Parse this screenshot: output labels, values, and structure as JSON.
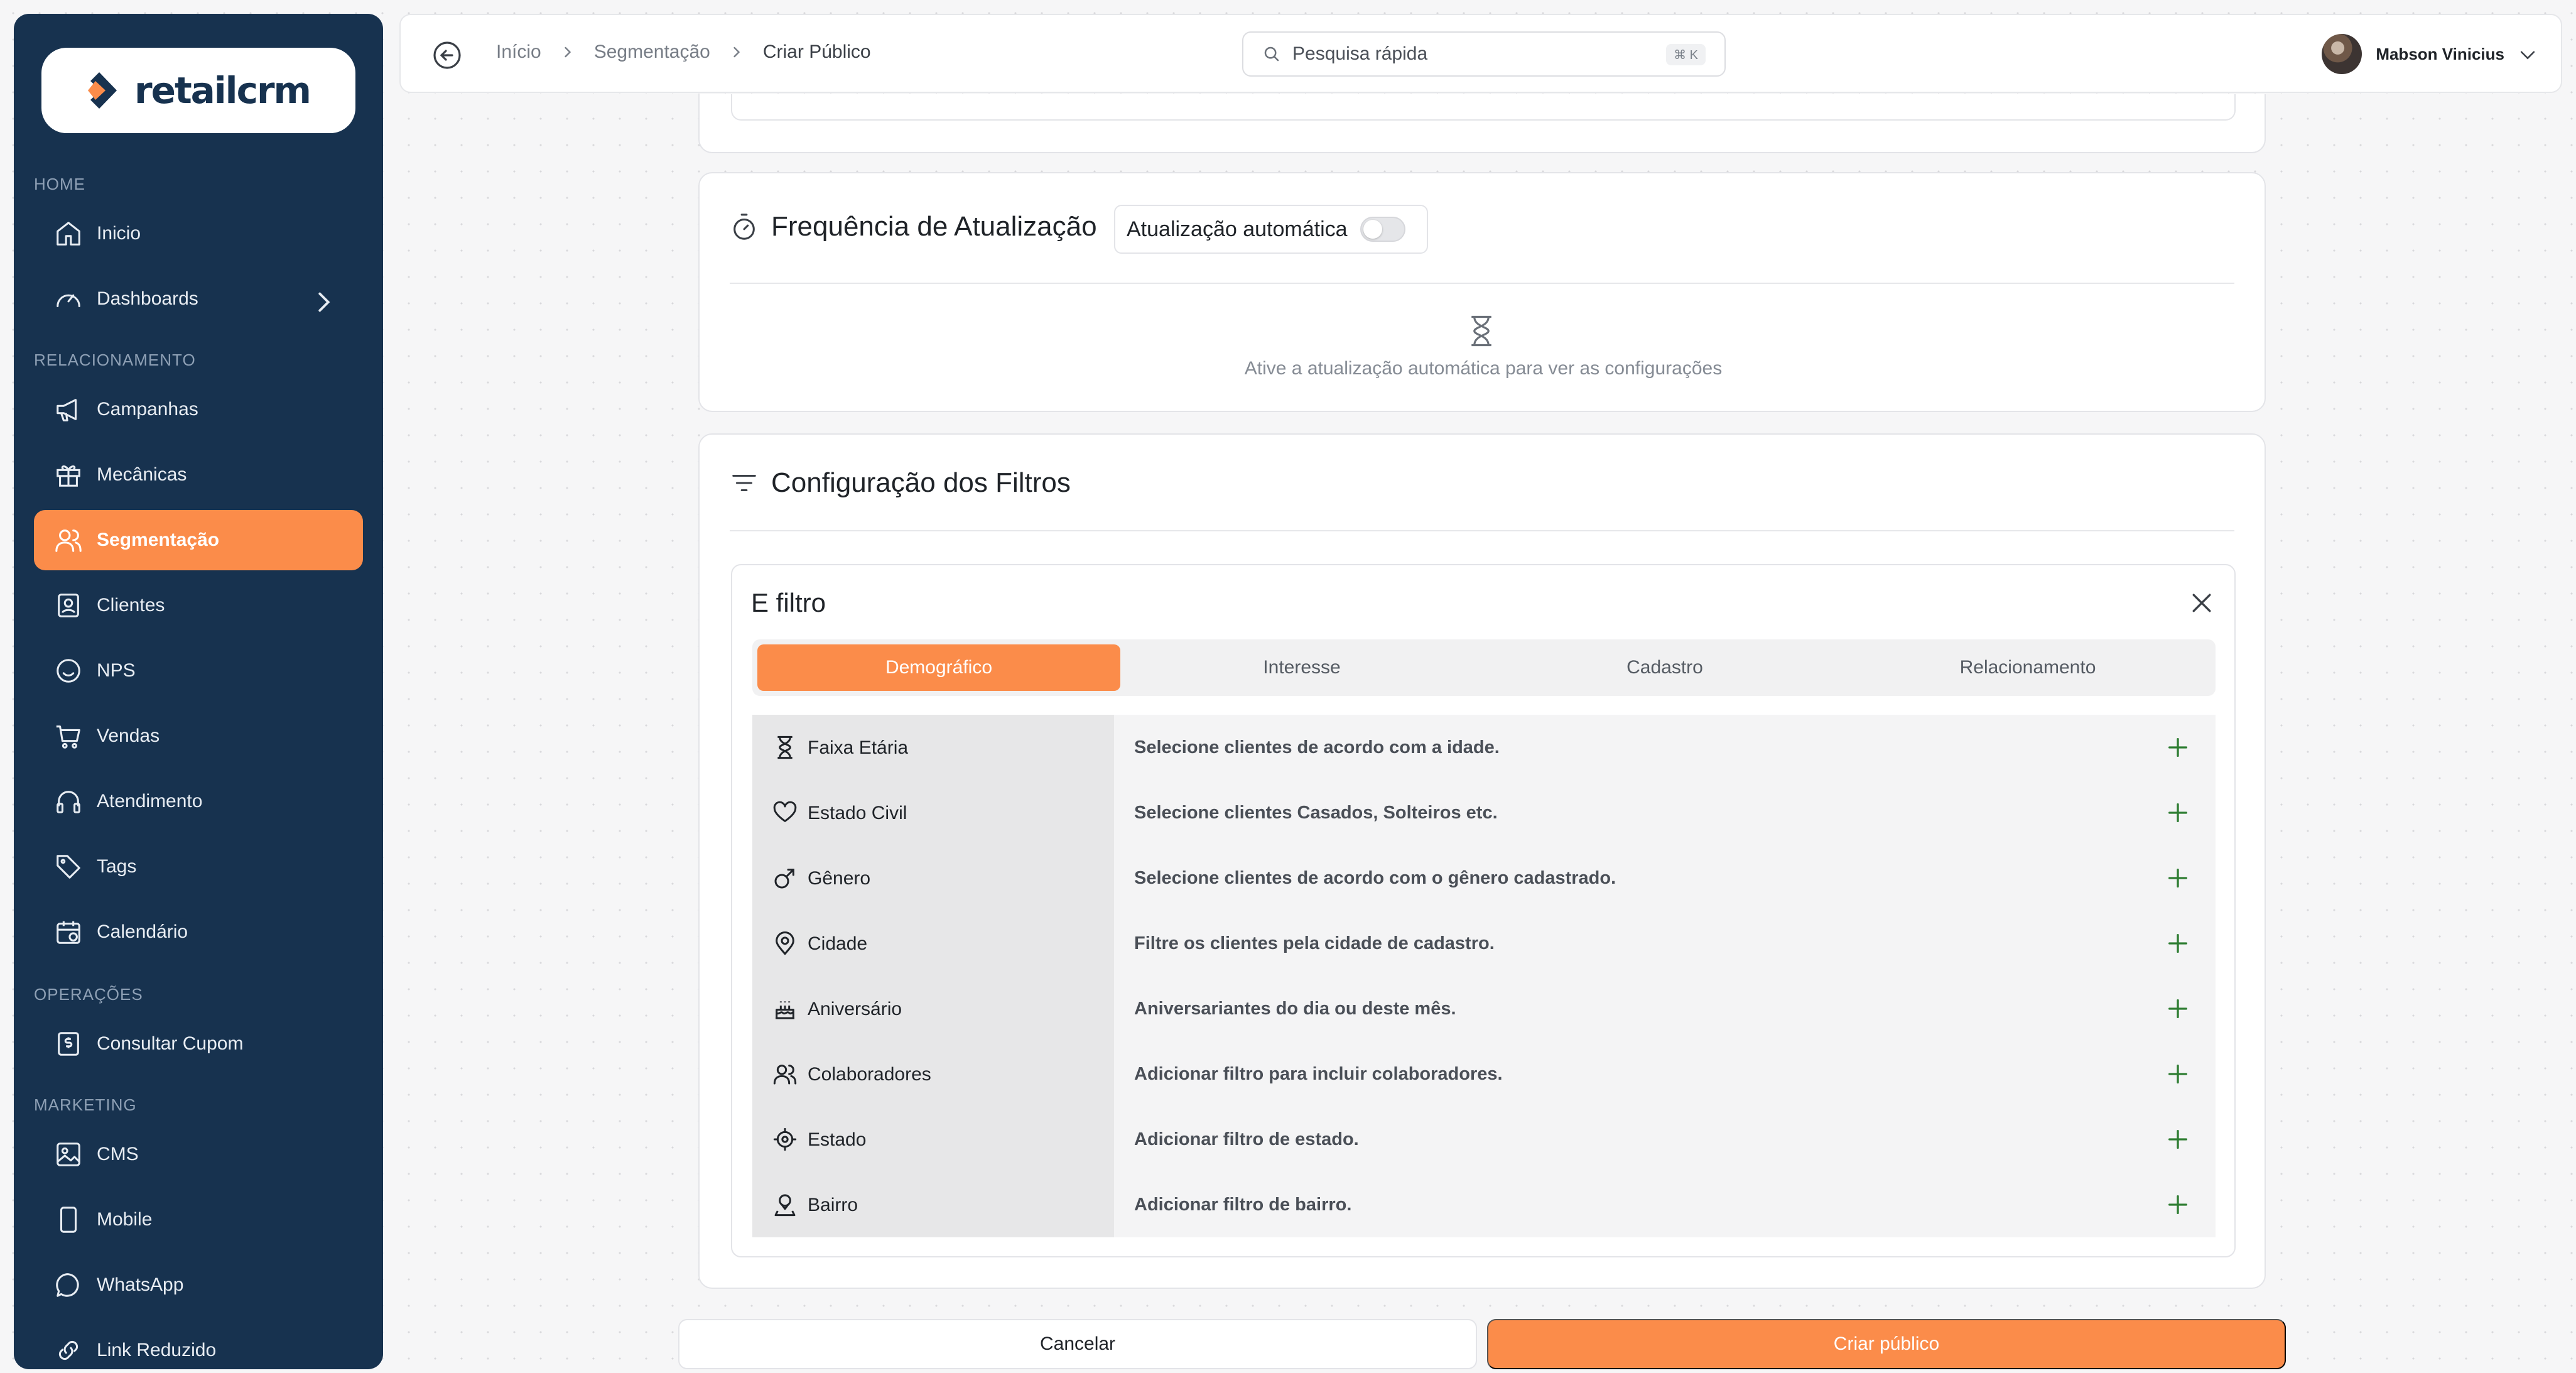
{
  "colors": {
    "sidebar_bg": "#17324f",
    "accent": "#fb8c4a",
    "add_icon": "#2e7d32"
  },
  "brand": {
    "logo_text": "retailcrm"
  },
  "sidebar": {
    "sections": [
      {
        "label": "HOME",
        "items": [
          {
            "label": "Inicio",
            "icon": "home-icon"
          },
          {
            "label": "Dashboards",
            "icon": "gauge-icon"
          }
        ]
      },
      {
        "label": "RELACIONAMENTO",
        "items": [
          {
            "label": "Campanhas",
            "icon": "megaphone-icon"
          },
          {
            "label": "Mecânicas",
            "icon": "gift-icon"
          },
          {
            "label": "Segmentação",
            "icon": "users-icon",
            "active": true
          },
          {
            "label": "Clientes",
            "icon": "contact-icon"
          },
          {
            "label": "NPS",
            "icon": "smile-icon"
          },
          {
            "label": "Vendas",
            "icon": "cart-icon"
          },
          {
            "label": "Atendimento",
            "icon": "headset-icon"
          },
          {
            "label": "Tags",
            "icon": "tag-icon"
          },
          {
            "label": "Calendário",
            "icon": "calendar-icon"
          }
        ]
      },
      {
        "label": "OPERAÇÕES",
        "items": [
          {
            "label": "Consultar Cupom",
            "icon": "receipt-icon"
          }
        ]
      },
      {
        "label": "MARKETING",
        "items": [
          {
            "label": "CMS",
            "icon": "image-icon"
          },
          {
            "label": "Mobile",
            "icon": "smartphone-icon"
          },
          {
            "label": "WhatsApp",
            "icon": "chat-icon"
          },
          {
            "label": "Link Reduzido",
            "icon": "link-icon"
          }
        ]
      }
    ]
  },
  "header": {
    "breadcrumb": [
      "Início",
      "Segmentação",
      "Criar Público"
    ],
    "search_placeholder": "Pesquisa rápida",
    "search_shortcut": "⌘ K",
    "user_name": "Mabson Vinicius"
  },
  "frequency": {
    "title": "Frequência de Atualização",
    "toggle_label": "Atualização automática",
    "toggle_on": false,
    "empty_message": "Ative a atualização automática para ver as configurações"
  },
  "filters_config": {
    "title": "Configuração dos Filtros",
    "box_title": "E filtro",
    "tabs": [
      "Demográfico",
      "Interesse",
      "Cadastro",
      "Relacionamento"
    ],
    "active_tab": 0,
    "rows": [
      {
        "label": "Faixa Etária",
        "icon": "hourglass-icon",
        "description": "Selecione clientes de acordo com a idade."
      },
      {
        "label": "Estado Civil",
        "icon": "heart-icon",
        "description": "Selecione clientes Casados, Solteiros etc."
      },
      {
        "label": "Gênero",
        "icon": "gender-icon",
        "description": "Selecione clientes de acordo com o gênero cadastrado."
      },
      {
        "label": "Cidade",
        "icon": "map-pin-icon",
        "description": "Filtre os clientes pela cidade de cadastro."
      },
      {
        "label": "Aniversário",
        "icon": "cake-icon",
        "description": "Aniversariantes do dia ou deste mês."
      },
      {
        "label": "Colaboradores",
        "icon": "users-icon",
        "description": "Adicionar filtro para incluir colaboradores."
      },
      {
        "label": "Estado",
        "icon": "locate-icon",
        "description": "Adicionar filtro de estado."
      },
      {
        "label": "Bairro",
        "icon": "map-person-icon",
        "description": "Adicionar filtro de bairro."
      }
    ]
  },
  "footer": {
    "cancel_label": "Cancelar",
    "create_label": "Criar público"
  }
}
